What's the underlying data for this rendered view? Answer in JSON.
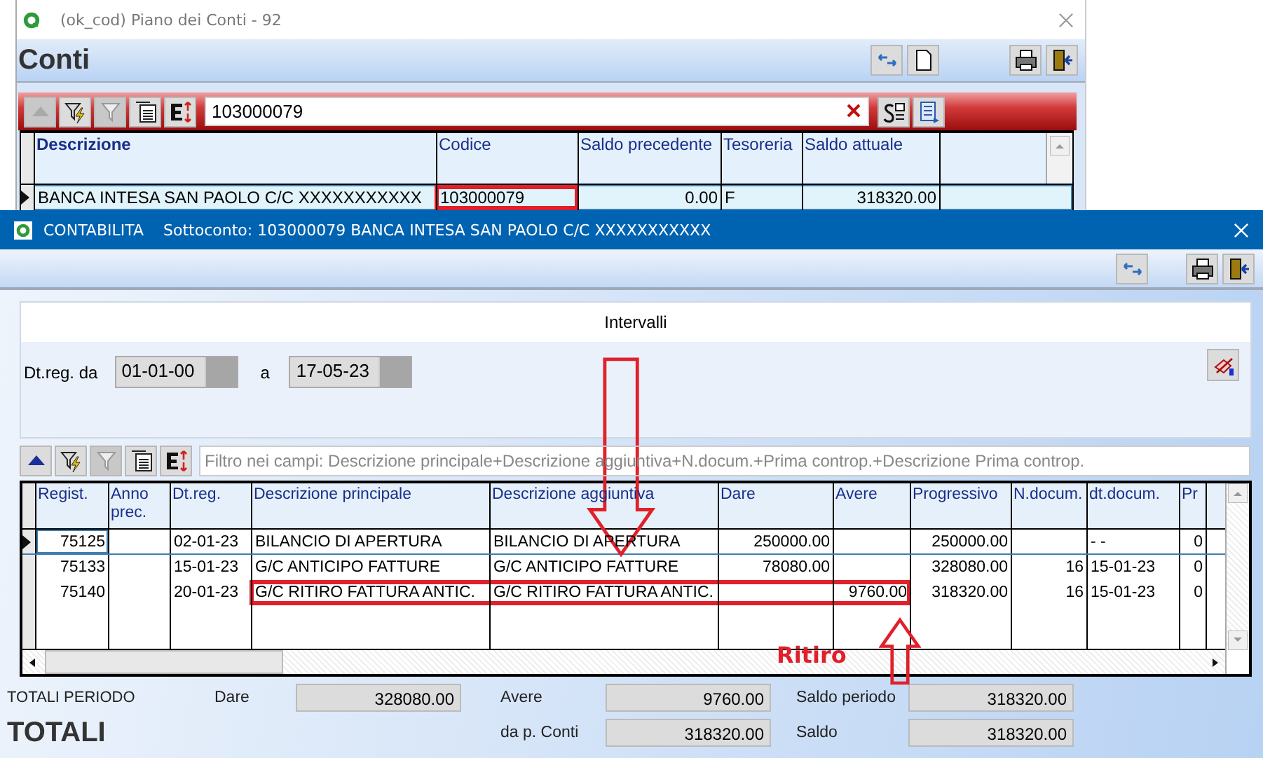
{
  "back_window": {
    "title": "(ok_cod) Piano dei Conti - 92",
    "heading": "Conti",
    "header_tools": [
      {
        "kind": "refresh",
        "disabled": false
      },
      {
        "kind": "new",
        "disabled": false
      },
      {
        "kind": "print",
        "disabled": false
      },
      {
        "kind": "exit",
        "disabled": false
      }
    ],
    "toolbar": [
      {
        "kind": "up",
        "disabled": true
      },
      {
        "kind": "filter-edit",
        "disabled": false
      },
      {
        "kind": "filter",
        "disabled": true
      },
      {
        "kind": "list",
        "disabled": false
      },
      {
        "kind": "export",
        "disabled": false
      }
    ],
    "search": {
      "value": "103000079"
    },
    "search_tools": [
      {
        "kind": "sort",
        "disabled": false
      },
      {
        "kind": "columns",
        "disabled": false
      }
    ],
    "table": {
      "columns": [
        {
          "label": "Descrizione",
          "kind": "text",
          "bold": true
        },
        {
          "label": "Codice",
          "kind": "text",
          "bold": false
        },
        {
          "label": "Saldo precedente",
          "kind": "number",
          "bold": false
        },
        {
          "label": "Tesoreria",
          "kind": "text",
          "bold": false
        },
        {
          "label": "Saldo attuale",
          "kind": "number",
          "bold": false
        }
      ],
      "rows": [
        {
          "selected": true,
          "marked_cells": [
            false,
            true,
            false,
            false,
            false
          ],
          "cells": [
            "BANCA INTESA SAN PAOLO C/C XXXXXXXXXXX",
            "103000079",
            "0.00",
            "F",
            "318320.00"
          ]
        }
      ]
    }
  },
  "front_window": {
    "title": "CONTABILITA",
    "subtitle": "Sottoconto: 103000079 BANCA INTESA SAN PAOLO C/C XXXXXXXXXXX",
    "header_tools": [
      {
        "kind": "refresh",
        "disabled": false
      },
      {
        "kind": "print",
        "disabled": false
      },
      {
        "kind": "exit",
        "disabled": false
      }
    ],
    "intervals": {
      "title": "Intervalli",
      "from_label": "Dt.reg. da",
      "from": "01-01-00",
      "to_label": "a",
      "to": "17-05-23"
    },
    "toolbar": [
      {
        "kind": "up",
        "disabled": false
      },
      {
        "kind": "filter-edit",
        "disabled": false
      },
      {
        "kind": "filter",
        "disabled": true
      },
      {
        "kind": "list",
        "disabled": false
      },
      {
        "kind": "export",
        "disabled": false
      }
    ],
    "filter": {
      "placeholder": "Filtro nei campi: Descrizione principale+Descrizione aggiuntiva+N.docum.+Prima controp.+Descrizione Prima controp."
    },
    "table": {
      "columns": [
        {
          "label": "Regist.",
          "kind": "number"
        },
        {
          "label": "Anno prec.",
          "kind": "text"
        },
        {
          "label": "Dt.reg.",
          "kind": "text"
        },
        {
          "label": "Descrizione principale",
          "kind": "text"
        },
        {
          "label": "Descrizione aggiuntiva",
          "kind": "text"
        },
        {
          "label": "Dare",
          "kind": "number"
        },
        {
          "label": "Avere",
          "kind": "number"
        },
        {
          "label": "Progressivo",
          "kind": "number"
        },
        {
          "label": "N.docum.",
          "kind": "number"
        },
        {
          "label": "dt.docum.",
          "kind": "text"
        },
        {
          "label": "Pr",
          "kind": "number"
        }
      ],
      "rows": [
        {
          "selected": true,
          "marked_cells": [
            false,
            false,
            false,
            false,
            false,
            false,
            false,
            false,
            false,
            false,
            false
          ],
          "cells": [
            "75125",
            null,
            "02-01-23",
            "BILANCIO DI APERTURA",
            "BILANCIO DI APERTURA",
            "250000.00",
            null,
            "250000.00",
            null,
            "- -",
            "0"
          ]
        },
        {
          "selected": false,
          "marked_cells": [
            false,
            false,
            false,
            false,
            false,
            false,
            false,
            false,
            false,
            false,
            false
          ],
          "cells": [
            "75133",
            null,
            "15-01-23",
            "G/C ANTICIPO FATTURE",
            "G/C ANTICIPO FATTURE",
            "78080.00",
            null,
            "328080.00",
            "16",
            "15-01-23",
            "0"
          ]
        },
        {
          "selected": false,
          "marked_cells": [
            false,
            false,
            false,
            true,
            true,
            true,
            true,
            false,
            false,
            false,
            false
          ],
          "cells": [
            "75140",
            null,
            "20-01-23",
            "G/C RITIRO FATTURA ANTIC.",
            "G/C RITIRO FATTURA ANTIC.",
            null,
            "9760.00",
            "318320.00",
            "16",
            "15-01-23",
            "0"
          ]
        }
      ]
    },
    "totals": {
      "period_label": "TOTALI PERIODO",
      "title": "TOTALI",
      "fields": [
        {
          "label": "Dare",
          "value": "328080.00"
        },
        {
          "label": "Avere",
          "value": "9760.00"
        },
        {
          "label": "Saldo periodo",
          "value": "318320.00"
        },
        {
          "label": "da p. Conti",
          "value": "318320.00"
        },
        {
          "label": "Saldo",
          "value": "318320.00"
        }
      ]
    }
  },
  "annotation": {
    "label": "Ritiro"
  }
}
